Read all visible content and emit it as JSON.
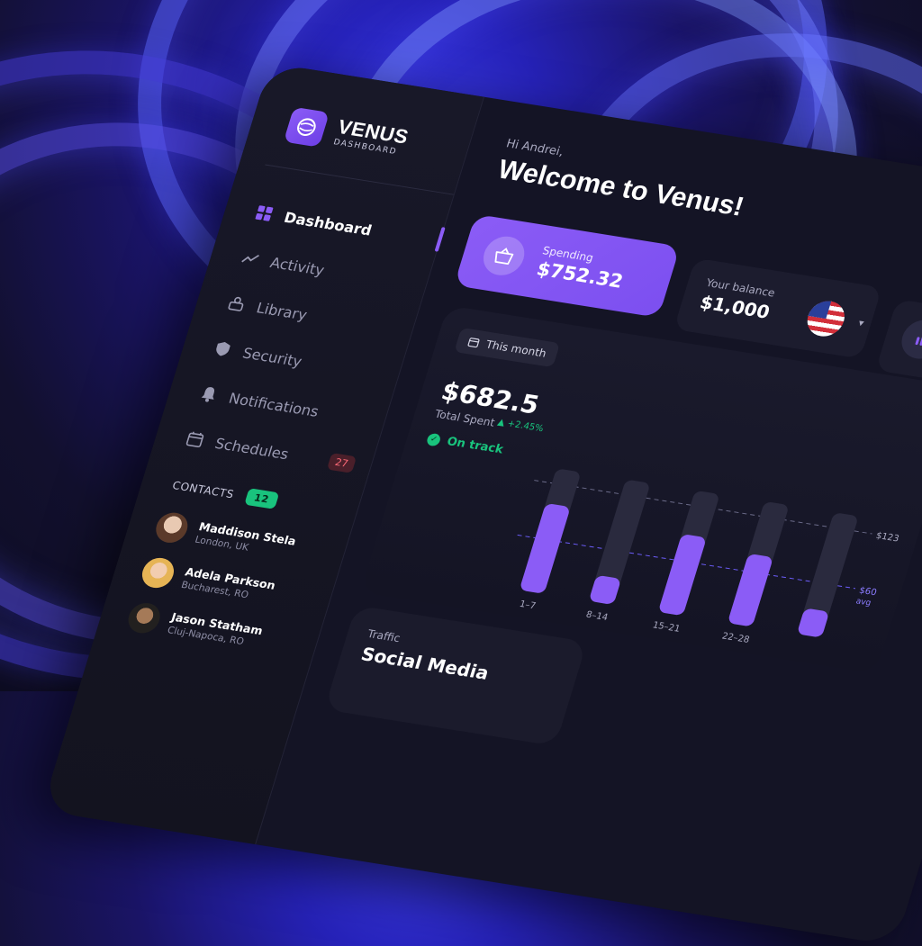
{
  "brand": {
    "title": "VENUS",
    "subtitle": "DASHBOARD"
  },
  "sidebar": {
    "items": [
      {
        "label": "Dashboard",
        "icon": "grid-icon",
        "active": true
      },
      {
        "label": "Activity",
        "icon": "activity-icon"
      },
      {
        "label": "Library",
        "icon": "library-icon"
      },
      {
        "label": "Security",
        "icon": "shield-icon"
      },
      {
        "label": "Notifications",
        "icon": "bell-icon"
      },
      {
        "label": "Schedules",
        "icon": "calendar-icon",
        "badge": "27"
      }
    ],
    "contacts_label": "CONTACTS",
    "contacts_count": "12",
    "contacts": [
      {
        "name": "Maddison Stela",
        "location": "London, UK"
      },
      {
        "name": "Adela Parkson",
        "location": "Bucharest, RO"
      },
      {
        "name": "Jason Statham",
        "location": "Cluj-Napoca, RO"
      }
    ]
  },
  "header": {
    "greeting": "Hi Andrei,",
    "title": "Welcome to Venus!"
  },
  "spending": {
    "label": "Spending",
    "amount": "$752.32"
  },
  "balance": {
    "label": "Your balance",
    "amount": "$1,000",
    "currency_flag": "us-flag-icon"
  },
  "summary": {
    "period": "This month",
    "total": "$682.5",
    "total_label": "Total Spent",
    "change": "+2.45%",
    "status": "On track"
  },
  "traffic": {
    "label": "Traffic",
    "title": "Social Media"
  },
  "colors": {
    "accent": "#8b5cf6",
    "success": "#19c37d",
    "danger": "#ff6b78",
    "panel": "#141425"
  },
  "chart_data": {
    "type": "bar",
    "categories": [
      "1–7",
      "8–14",
      "15–21",
      "22–28",
      ""
    ],
    "values": [
      100,
      30,
      90,
      80,
      30
    ],
    "reference_lines": [
      {
        "label": "$123",
        "value": 123
      },
      {
        "label": "$60",
        "value": 60,
        "sublabel": "avg"
      }
    ]
  }
}
